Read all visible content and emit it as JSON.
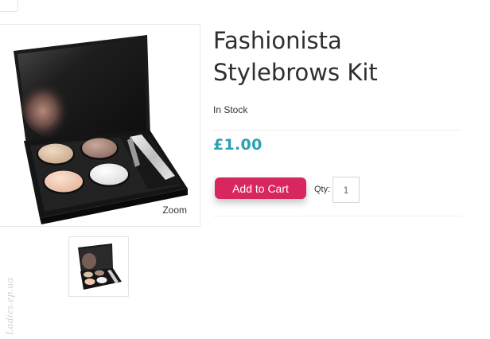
{
  "product": {
    "title": "Fashionista Stylebrows Kit",
    "stock_status": "In Stock",
    "price": "£1.00",
    "price_color": "#2aa0b2"
  },
  "gallery": {
    "zoom_label": "Zoom",
    "main_image_icon": "eyeshadow-palette-kit",
    "thumbnail_icon": "eyeshadow-palette-kit"
  },
  "cart": {
    "add_to_cart_label": "Add to Cart",
    "button_color": "#d8275f",
    "qty_label": "Qty:",
    "qty_value": "1"
  },
  "watermark": {
    "text": "Ladies.ep.ua"
  }
}
